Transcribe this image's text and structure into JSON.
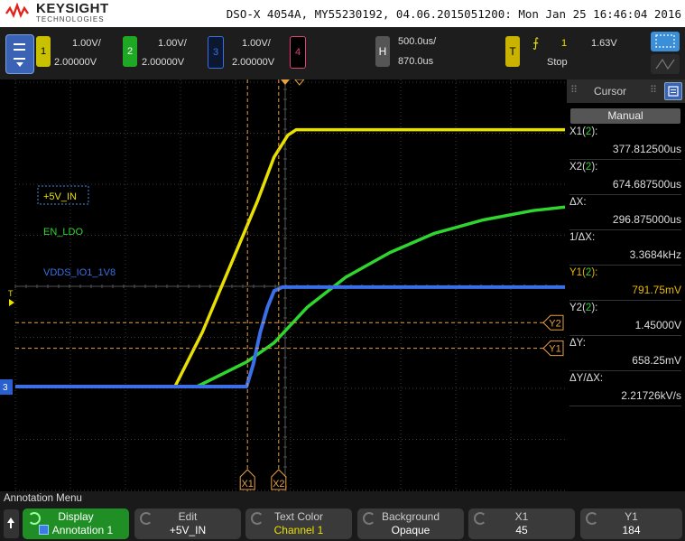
{
  "header": {
    "brand": "KEYSIGHT",
    "brand_sub": "TECHNOLOGIES",
    "info": "DSO-X 4054A, MY55230192, 04.06.2015051200: Mon Jan 25 16:46:04 2016"
  },
  "channels": [
    {
      "num": "1",
      "scale": "1.00V/",
      "offset": "2.00000V",
      "color": "#e8e000"
    },
    {
      "num": "2",
      "scale": "1.00V/",
      "offset": "2.00000V",
      "color": "#2fd62f"
    },
    {
      "num": "3",
      "scale": "1.00V/",
      "offset": "2.00000V",
      "color": "#3a6fe8"
    },
    {
      "num": "4",
      "color": "#e0407a"
    }
  ],
  "horizontal": {
    "label": "H",
    "timebase": "500.0us/",
    "delay": "870.0us"
  },
  "trigger": {
    "label": "T",
    "edge": "⨍",
    "source": "1",
    "level": "1.63V",
    "status": "Stop"
  },
  "cursor_panel": {
    "title": "Cursor",
    "mode": "Manual",
    "rows": [
      {
        "label": "X1(2):",
        "value": "377.812500us"
      },
      {
        "label": "X2(2):",
        "value": "674.687500us"
      },
      {
        "label": "ΔX:",
        "value": "296.875000us"
      },
      {
        "label": "1/ΔX:",
        "value": "3.3684kHz"
      },
      {
        "label": "Y1(2):",
        "value": "791.75mV",
        "highlight": true
      },
      {
        "label": "Y2(2):",
        "value": "1.45000V"
      },
      {
        "label": "ΔY:",
        "value": "658.25mV"
      },
      {
        "label": "ΔY/ΔX:",
        "value": "2.21726kV/s"
      }
    ]
  },
  "annotation_menu": {
    "title": "Annotation Menu",
    "softkeys": [
      {
        "top": "Display",
        "bottom": "Annotation 1",
        "active": true
      },
      {
        "top": "Edit",
        "bottom": "+5V_IN"
      },
      {
        "top": "Text Color",
        "bottom": "Channel 1",
        "bottom_color": "#e8e000"
      },
      {
        "top": "Background",
        "bottom": "Opaque"
      },
      {
        "top": "X1",
        "bottom": "45"
      },
      {
        "top": "Y1",
        "bottom": "184"
      }
    ]
  },
  "chart_data": {
    "type": "line",
    "annotations": [
      "+5V_IN",
      "EN_LDO",
      "VDDS_IO1_1V8"
    ],
    "cursor_labels": {
      "x1": "X1",
      "x2": "X2",
      "y1": "Y1",
      "y2": "Y2"
    },
    "trigger_marker": "T",
    "ground_marker": "3",
    "grid": true,
    "series": [
      {
        "name": "+5V_IN",
        "color": "#e8e000",
        "x_div": [
          0,
          2.9,
          3.4,
          3.9,
          4.4,
          4.7,
          4.95,
          5.1,
          10.3
        ],
        "y_div": [
          -1.0,
          -1.0,
          0.0,
          1.2,
          2.4,
          3.2,
          3.6,
          3.7,
          3.7
        ]
      },
      {
        "name": "EN_LDO",
        "color": "#2fd62f",
        "x_div": [
          0,
          3.3,
          3.7,
          4.2,
          4.7,
          5.3,
          6.0,
          6.8,
          7.6,
          8.5,
          9.4,
          10.3
        ],
        "y_div": [
          -1.0,
          -1.0,
          -0.8,
          -0.55,
          -0.2,
          0.45,
          1.0,
          1.45,
          1.8,
          2.05,
          2.22,
          2.32
        ]
      },
      {
        "name": "VDDS_IO1_1V8",
        "color": "#3a6fe8",
        "x_div": [
          0,
          4.2,
          4.32,
          4.45,
          4.58,
          4.7,
          4.85,
          10.3
        ],
        "y_div": [
          -1.0,
          -1.0,
          -0.6,
          0.0,
          0.45,
          0.75,
          0.82,
          0.82
        ]
      }
    ],
    "cursors": {
      "x1_div": 4.2,
      "x2_div": 4.8,
      "y1_div": -0.2,
      "y2_div": 0.45,
      "trigger_div": 0.9
    },
    "xlim_div": [
      0,
      10.3
    ],
    "ylim_div": [
      -3.25,
      4.35
    ]
  }
}
